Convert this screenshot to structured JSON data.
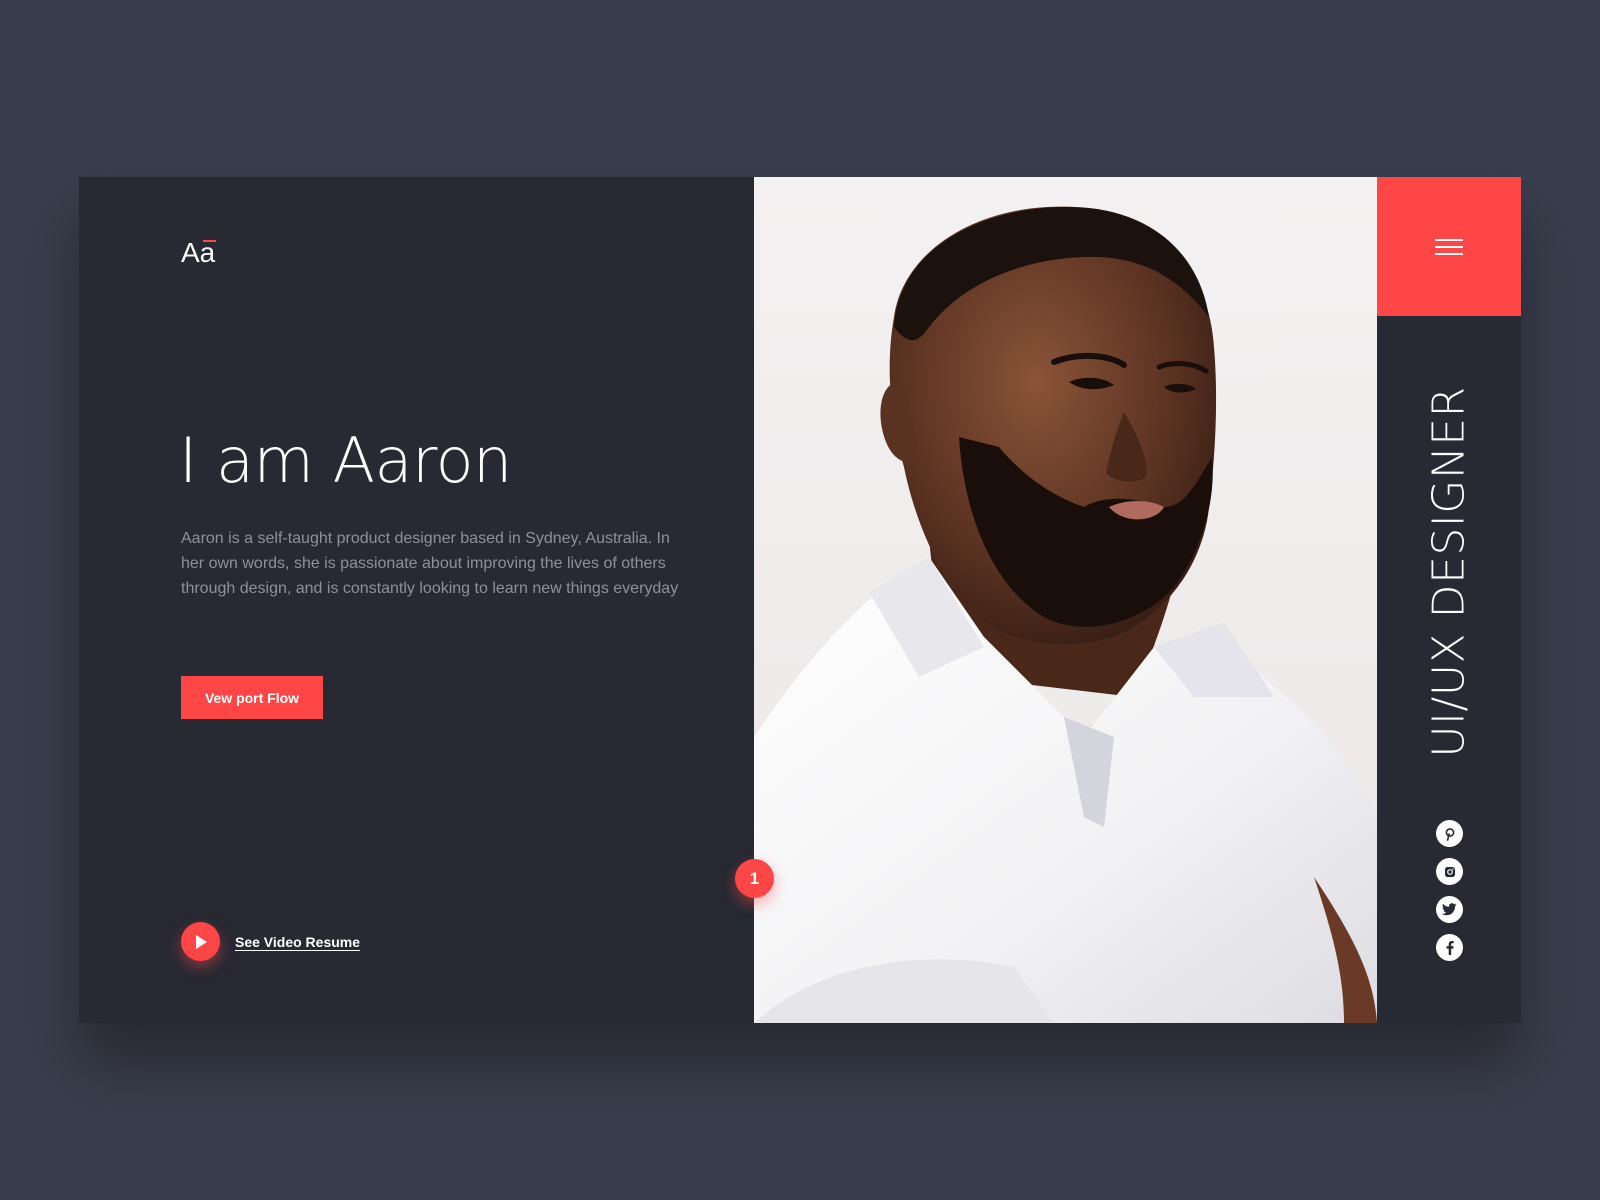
{
  "brand": {
    "logo_text": "Aa"
  },
  "hero": {
    "headline": "I am Aaron",
    "bio": "Aaron is a self-taught product designer based in Sydney, Australia. In her own words, she is passionate about improving the lives of others through design, and is constantly looking to learn new things everyday",
    "cta_label": "Vew port Flow",
    "video_label": "See Video Resume"
  },
  "slide_badge": "1",
  "sidebar": {
    "role": "UI/UX DESIGNER",
    "menu_icon": "hamburger-menu-icon",
    "socials": [
      {
        "icon": "pinterest-icon"
      },
      {
        "icon": "instagram-icon"
      },
      {
        "icon": "twitter-icon"
      },
      {
        "icon": "facebook-icon"
      }
    ]
  },
  "colors": {
    "background": "#3a3e4c",
    "panel": "#272933",
    "accent": "#ff4646",
    "bio_text": "#8e919c"
  }
}
